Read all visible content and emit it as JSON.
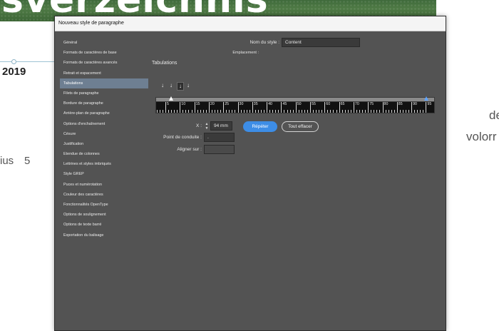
{
  "background_doc": {
    "banner_text": "sverzeichnis",
    "year": "2019",
    "partial_ius": "ius",
    "partial_five": "5",
    "partial_de": "de",
    "partial_volorr": "volorr"
  },
  "dialog": {
    "title": "Nouveau style de paragraphe",
    "sidebar_items": [
      "Général",
      "Formats de caractères de base",
      "Formats de caractères avancés",
      "Retrait et espacement",
      "Tabulations",
      "Filets de paragraphe",
      "Bordure de paragraphe",
      "Arrière-plan de paragraphe",
      "Options d'enchaînement",
      "Césure",
      "Justification",
      "Etendue de colonnes",
      "Lettrines et styles imbriqués",
      "Style GREP",
      "Puces et numérotation",
      "Couleur des caractères",
      "Fonctionnalités OpenType",
      "Options de soulignement",
      "Options de texte barré",
      "Exportation du balisage"
    ],
    "active_item_index": 4,
    "style_name_label": "Nom du style :",
    "style_name_value": "Content",
    "location_label": "Emplacement :",
    "section_title": "Tabulations",
    "tab_align_icons": [
      "left-tab-icon",
      "center-tab-icon",
      "right-tab-icon",
      "decimal-tab-icon"
    ],
    "ruler_labels": [
      "5",
      "10",
      "15",
      "20",
      "25",
      "30",
      "35",
      "40",
      "45",
      "50",
      "55",
      "60",
      "65",
      "70",
      "75",
      "80",
      "85",
      "90",
      "95"
    ],
    "x_label": "X :",
    "x_value": "94 mm",
    "leader_label": "Point de conduite :",
    "leader_value": ".",
    "align_on_label": "Aligner sur :",
    "align_on_value": "",
    "repeat_button": "Répéter",
    "clear_all_button": "Tout effacer",
    "accent_color": "#3d8de6"
  }
}
